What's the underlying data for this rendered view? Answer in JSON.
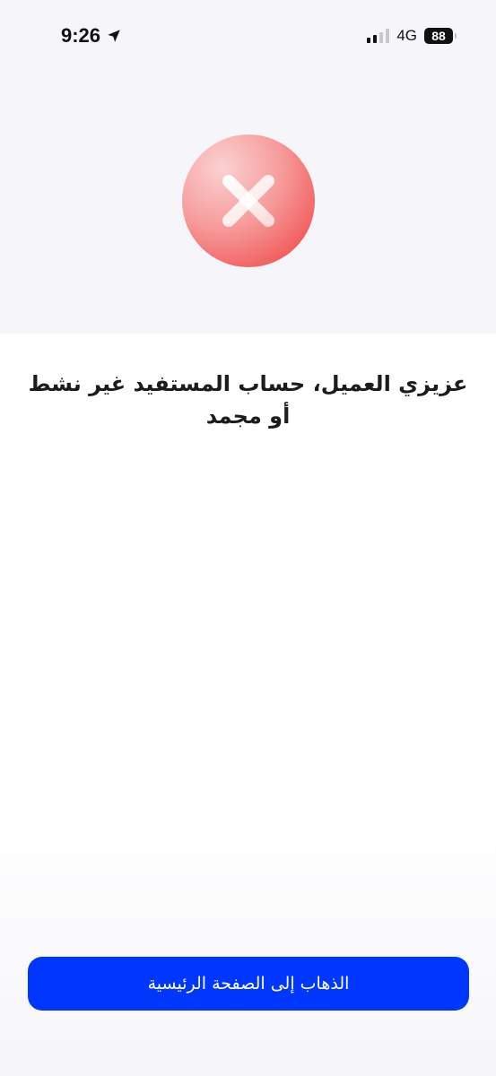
{
  "status_bar": {
    "time": "9:26",
    "location_icon": "location-arrow-icon",
    "signal_icon": "cellular-signal-icon",
    "network": "4G",
    "battery_level": "88",
    "battery_icon": "battery-icon"
  },
  "error_icon": "close-circle-icon",
  "message": {
    "text": "عزيزي العميل، حساب المستفيد غير نشط أو مجمد"
  },
  "home_button": {
    "label": "الذهاب إلى الصفحة الرئيسية"
  },
  "colors": {
    "primary_button": "#0037ff",
    "error_red": "#ef3b3b",
    "top_background": "#f6f6fa"
  }
}
